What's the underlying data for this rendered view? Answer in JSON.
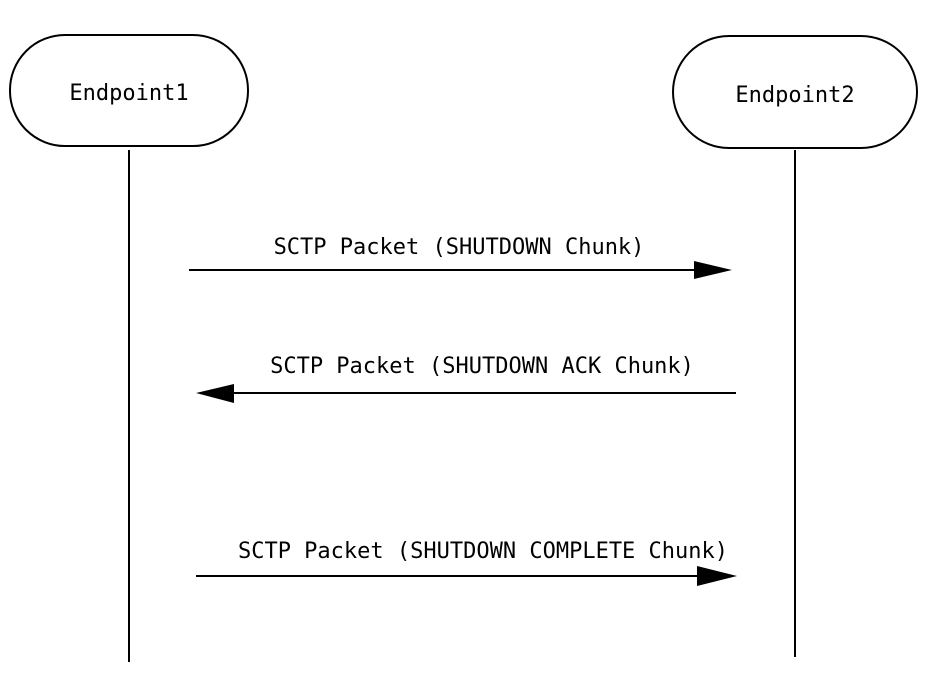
{
  "diagram": {
    "type": "sequence-diagram",
    "participants": [
      {
        "id": "ep1",
        "label": "Endpoint1"
      },
      {
        "id": "ep2",
        "label": "Endpoint2"
      }
    ],
    "messages": [
      {
        "from": "ep1",
        "to": "ep2",
        "label": "SCTP Packet (SHUTDOWN Chunk)"
      },
      {
        "from": "ep2",
        "to": "ep1",
        "label": "SCTP Packet (SHUTDOWN ACK Chunk)"
      },
      {
        "from": "ep1",
        "to": "ep2",
        "label": "SCTP Packet (SHUTDOWN COMPLETE Chunk)"
      }
    ],
    "colors": {
      "stroke": "#000000",
      "background": "#ffffff"
    }
  }
}
